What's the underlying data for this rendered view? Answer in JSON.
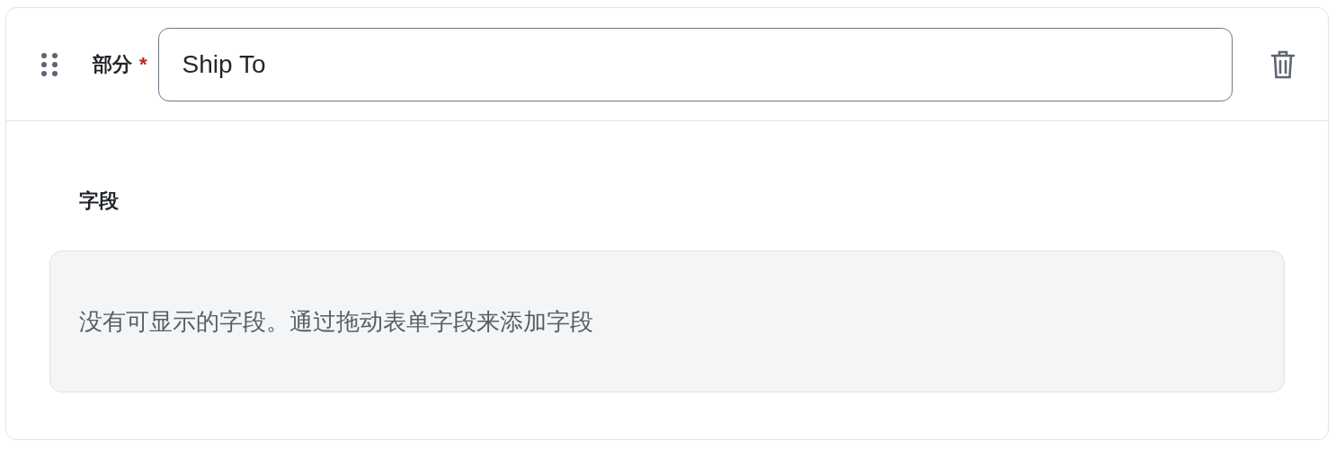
{
  "section": {
    "label": "部分",
    "required_mark": "*",
    "value": "Ship To"
  },
  "fields": {
    "heading": "字段",
    "empty_message": "没有可显示的字段。通过拖动表单字段来添加字段"
  }
}
